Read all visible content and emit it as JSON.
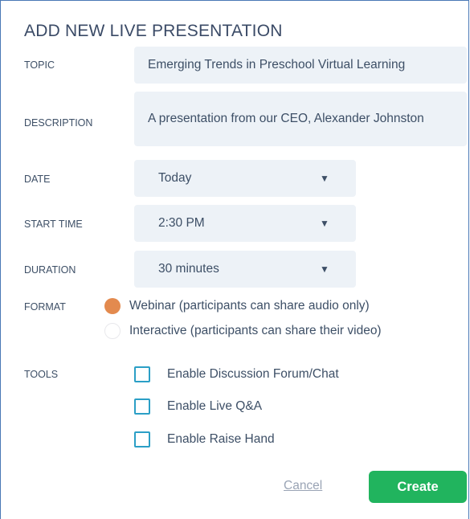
{
  "dialog": {
    "title": "ADD NEW LIVE PRESENTATION"
  },
  "fields": {
    "topic": {
      "label": "TOPIC",
      "value": "Emerging Trends in Preschool Virtual Learning"
    },
    "description": {
      "label": "DESCRIPTION",
      "value": "A presentation from our CEO, Alexander Johnston"
    },
    "date": {
      "label": "DATE",
      "value": "Today"
    },
    "start_time": {
      "label": "START TIME",
      "value": "2:30 PM"
    },
    "duration": {
      "label": "DURATION",
      "value": "30 minutes"
    }
  },
  "format": {
    "label": "FORMAT",
    "options": [
      {
        "label": "Webinar (participants can share audio only)",
        "selected": true
      },
      {
        "label": "Interactive (participants can share their video)",
        "selected": false
      }
    ]
  },
  "tools": {
    "label": "TOOLS",
    "options": [
      {
        "label": "Enable Discussion Forum/Chat",
        "checked": false
      },
      {
        "label": "Enable Live Q&A",
        "checked": false
      },
      {
        "label": "Enable Raise Hand",
        "checked": false
      }
    ]
  },
  "actions": {
    "cancel_label": "Cancel",
    "create_label": "Create"
  },
  "colors": {
    "accent_create": "#21b45e",
    "radio_selected": "#e38a4e",
    "checkbox_border": "#2b9fc6",
    "field_background": "#edf2f7"
  }
}
